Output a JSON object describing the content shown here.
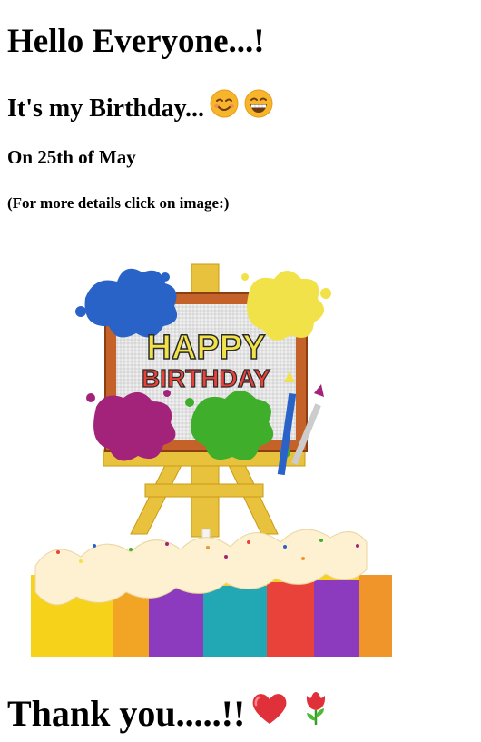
{
  "heading_hello": "Hello Everyone...!",
  "heading_birthday": "It's my Birthday...",
  "heading_date": "On 25th of May",
  "heading_details": "(For more details click on image:)",
  "image": {
    "topper_line1": "HAPPY",
    "topper_line2": "BIRTHDAY"
  },
  "thanks": "Thank you.....!!",
  "icons": [
    "smiling-face-icon",
    "grinning-face-icon",
    "heart-icon",
    "tulip-icon"
  ],
  "colors": {
    "text": "#000000",
    "background": "#ffffff",
    "easel_gold": "#e8c23c",
    "heart_red": "#e0303a"
  }
}
